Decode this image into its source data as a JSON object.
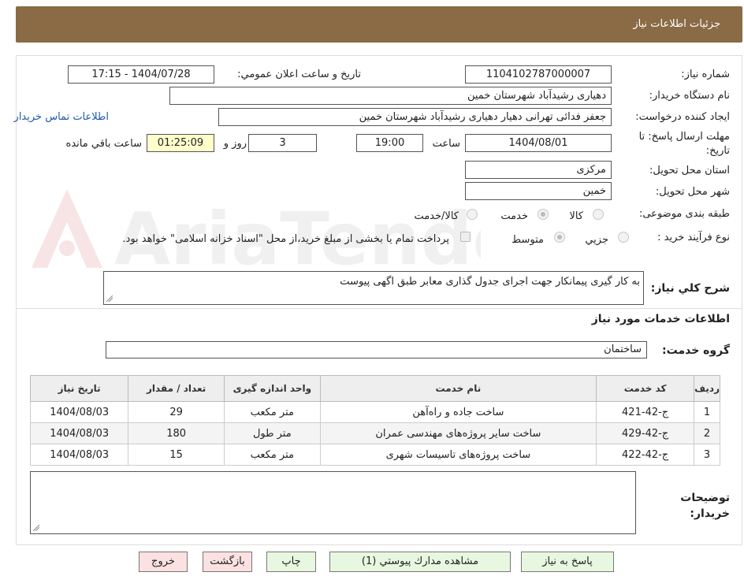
{
  "header": {
    "title": "جزئیات اطلاعات نیاز"
  },
  "fields": {
    "need_number_label": "شماره نیاز:",
    "need_number": "1104102787000007",
    "announce_label": "تاریخ و ساعت اعلان عمومي:",
    "announce_value": "1404/07/28 - 17:15",
    "buyer_org_label": "نام دستگاه خریدار:",
    "buyer_org": "دهیاری رشیدآباد شهرستان خمین",
    "creator_label": "ایجاد کننده درخواست:",
    "creator": "جعفر فدائی تهرانی دهیار دهیاری رشیدآباد شهرستان خمین",
    "contact_link": "اطلاعات تماس خریدار",
    "deadline_label": "مهلت ارسال پاسخ: تا تاریخ:",
    "deadline_date": "1404/08/01",
    "time_label": "ساعت",
    "deadline_time": "19:00",
    "days_value": "3",
    "days_label": "روز و",
    "remaining_value": "01:25:09",
    "remaining_label": "ساعت باقي مانده",
    "province_label": "استان محل تحویل:",
    "province": "مرکزی",
    "city_label": "شهر محل تحویل:",
    "city": "خمین",
    "category_label": "طبقه بندی موضوعی:",
    "category_options": [
      "کالا",
      "خدمت",
      "کالا/خدمت"
    ],
    "purchase_type_label": "نوع فرآیند خرید :",
    "purchase_options": [
      "جزيي",
      "متوسط"
    ],
    "payment_note": "پرداخت تمام یا بخشی از مبلغ خرید،از محل \"اسناد خزانه اسلامی\" خواهد بود.",
    "description_label": "شرح کلي نیاز:",
    "description": "به کار گیری پیمانکار جهت اجرای جدول گذاری معابر طبق اگهی پیوست",
    "services_title": "اطلاعات خدمات مورد نیاز",
    "service_group_label": "گروه خدمت:",
    "service_group": "ساختمان",
    "buyer_notes_label": "توضیحات خریدار:"
  },
  "table": {
    "headers": [
      "ردیف",
      "کد خدمت",
      "نام خدمت",
      "واحد اندازه گیری",
      "تعداد / مقدار",
      "تاریخ نیاز"
    ],
    "rows": [
      [
        "1",
        "ج-42-421",
        "ساخت جاده و راه‌آهن",
        "متر مکعب",
        "29",
        "1404/08/03"
      ],
      [
        "2",
        "ج-42-429",
        "ساخت سایر پروژه‌های مهندسی عمران",
        "متر طول",
        "180",
        "1404/08/03"
      ],
      [
        "3",
        "ج-42-422",
        "ساخت پروژه‌های تاسیسات شهری",
        "متر مکعب",
        "15",
        "1404/08/03"
      ]
    ]
  },
  "buttons": {
    "reply": "پاسخ به نیاز",
    "attachments": "مشاهده مدارك پيوستي (1)",
    "print": "چاپ",
    "back": "بازگشت",
    "exit": "خروج"
  },
  "watermark": "AriaTender.net"
}
